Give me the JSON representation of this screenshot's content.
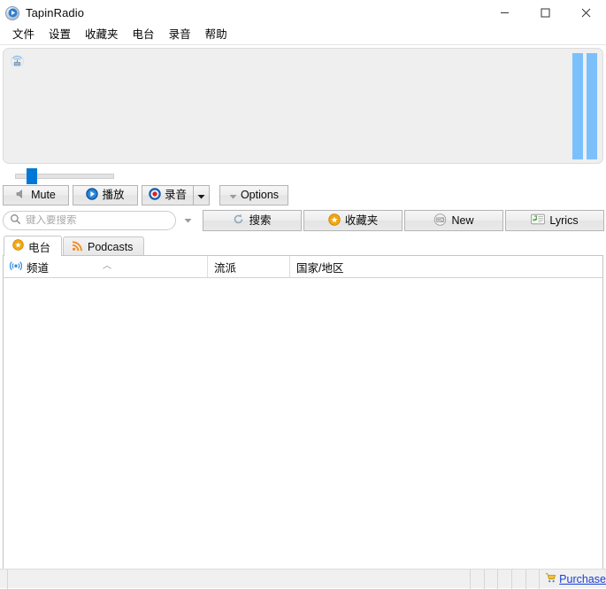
{
  "window": {
    "title": "TapinRadio",
    "app_icon": "play-circle-icon",
    "minimize_label": "Minimize",
    "maximize_label": "Maximize",
    "close_label": "Close"
  },
  "menubar": {
    "items": [
      {
        "label": "文件",
        "name": "menu-file"
      },
      {
        "label": "设置",
        "name": "menu-settings"
      },
      {
        "label": "收藏夹",
        "name": "menu-favorites"
      },
      {
        "label": "电台",
        "name": "menu-radio"
      },
      {
        "label": "录音",
        "name": "menu-recording"
      },
      {
        "label": "帮助",
        "name": "menu-help"
      }
    ]
  },
  "player": {
    "station_icon": "radio-tower-icon",
    "now_playing": "",
    "vu_meter": {
      "icon": "level-meter-icon",
      "bars": [
        100,
        100
      ],
      "color": "#7cc0fb"
    },
    "volume": {
      "value": 14,
      "min": 0,
      "max": 100,
      "handle_color": "#0078d7"
    }
  },
  "transport": {
    "mute": {
      "label": "Mute",
      "icon": "speaker-icon"
    },
    "play": {
      "label": "播放",
      "icon": "play-icon"
    },
    "record": {
      "label": "录音",
      "icon": "record-icon"
    },
    "record_dropdown": {
      "icon": "caret-down-icon"
    },
    "options": {
      "label": "Options",
      "icon": "caret-down-small-icon"
    }
  },
  "search": {
    "placeholder": "键入要搜索",
    "value": "",
    "icon": "search-icon",
    "dropdown_icon": "caret-down-icon"
  },
  "actions": [
    {
      "label": "搜索",
      "icon": "search-refresh-icon",
      "name": "search-button"
    },
    {
      "label": "收藏夹",
      "icon": "star-icon",
      "name": "favorites-button"
    },
    {
      "label": "New",
      "icon": "radio-icon",
      "name": "new-button"
    },
    {
      "label": "Lyrics",
      "icon": "lyrics-icon",
      "name": "lyrics-button"
    }
  ],
  "tabs": [
    {
      "label": "电台",
      "icon": "star-icon",
      "active": true,
      "name": "tab-radio"
    },
    {
      "label": "Podcasts",
      "icon": "rss-icon",
      "active": false,
      "name": "tab-podcasts"
    }
  ],
  "list": {
    "columns": [
      {
        "label": "频道",
        "icon": "broadcast-icon",
        "sorted": "asc",
        "sort_glyph": "︿"
      },
      {
        "label": "流派",
        "icon": "",
        "sorted": ""
      },
      {
        "label": "国家/地区",
        "icon": "",
        "sorted": ""
      }
    ],
    "rows": []
  },
  "statusbar": {
    "panes": [
      "",
      "",
      "",
      "",
      "",
      ""
    ],
    "purchase": {
      "label": "Purchase",
      "icon": "cart-icon",
      "color": "#1a3fd0"
    }
  }
}
